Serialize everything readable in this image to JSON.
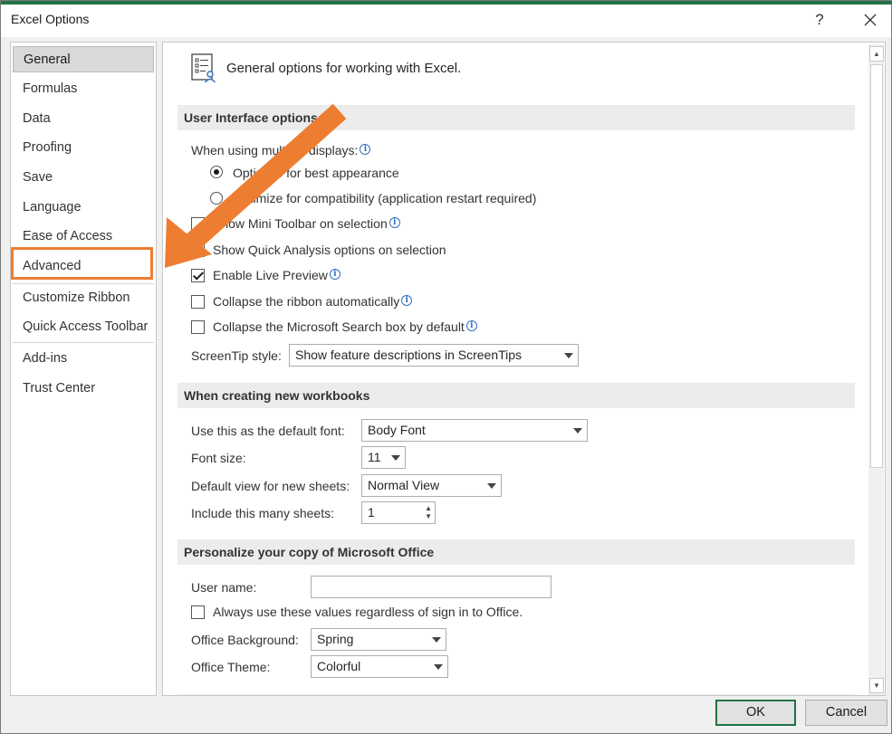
{
  "window": {
    "title": "Excel Options",
    "help_label": "?",
    "close_label": "✕"
  },
  "nav": {
    "items": [
      {
        "label": "General",
        "selected": true
      },
      {
        "label": "Formulas"
      },
      {
        "label": "Data"
      },
      {
        "label": "Proofing"
      },
      {
        "label": "Save"
      },
      {
        "label": "Language"
      },
      {
        "label": "Ease of Access"
      },
      {
        "label": "Advanced",
        "highlighted": true
      },
      {
        "label": "Customize Ribbon"
      },
      {
        "label": "Quick Access Toolbar"
      },
      {
        "label": "Add-ins"
      },
      {
        "label": "Trust Center"
      }
    ]
  },
  "page": {
    "header": "General options for working with Excel."
  },
  "ui_options": {
    "section_title": "User Interface options",
    "multi_display_label": "When using multiple displays:",
    "radio_optimize_appearance": "Optimize for best appearance",
    "radio_optimize_compat": "Optimize for compatibility (application restart required)",
    "show_mini_toolbar": "Show Mini Toolbar on selection",
    "show_quick_analysis": "Show Quick Analysis options on selection",
    "enable_live_preview": "Enable Live Preview",
    "collapse_ribbon": "Collapse the ribbon automatically",
    "collapse_search": "Collapse the Microsoft Search box by default",
    "screentip_label": "ScreenTip style:",
    "screentip_value": "Show feature descriptions in ScreenTips"
  },
  "new_workbooks": {
    "section_title": "When creating new workbooks",
    "font_label": "Use this as the default font:",
    "font_value": "Body Font",
    "size_label": "Font size:",
    "size_value": "11",
    "view_label": "Default view for new sheets:",
    "view_value": "Normal View",
    "sheets_label": "Include this many sheets:",
    "sheets_value": "1"
  },
  "personalize": {
    "section_title": "Personalize your copy of Microsoft Office",
    "username_label": "User name:",
    "username_value": "",
    "always_use": "Always use these values regardless of sign in to Office.",
    "background_label": "Office Background:",
    "background_value": "Spring",
    "theme_label": "Office Theme:",
    "theme_value": "Colorful"
  },
  "buttons": {
    "ok": "OK",
    "cancel": "Cancel"
  },
  "colors": {
    "accent_green": "#217346",
    "annotation_orange": "#ed7d31"
  }
}
